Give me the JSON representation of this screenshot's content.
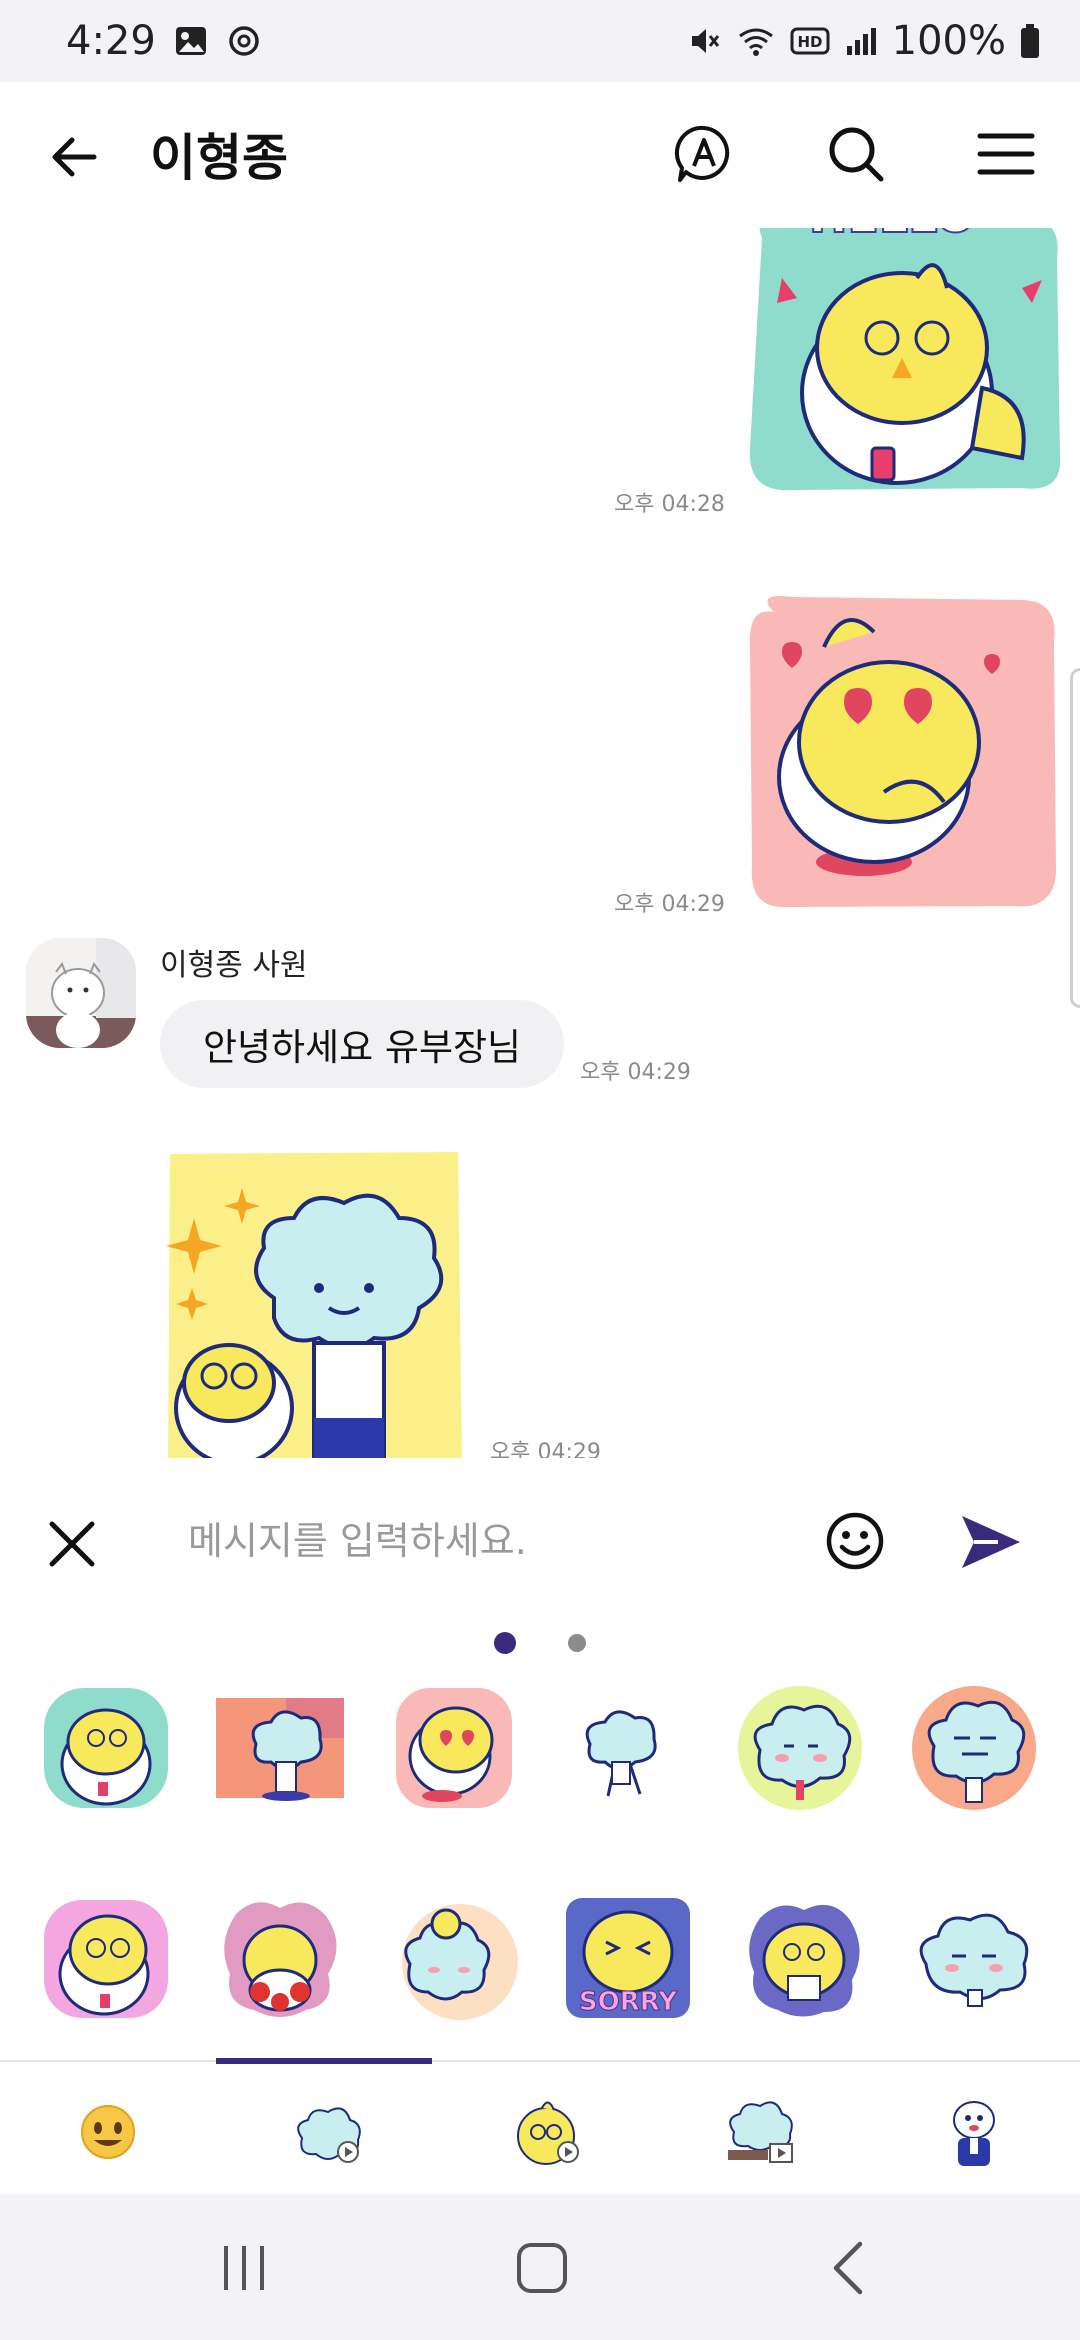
{
  "status_bar": {
    "time": "4:29",
    "battery": "100%",
    "icons": [
      "gallery-icon",
      "sync-icon",
      "mute-icon",
      "wifi-icon",
      "hd-icon",
      "signal-icon",
      "battery-icon"
    ]
  },
  "header": {
    "title": "이형종",
    "icons": [
      "back-arrow-icon",
      "translate-a-icon",
      "search-icon",
      "menu-icon"
    ]
  },
  "messages": [
    {
      "side": "right",
      "type": "sticker",
      "sticker": "hello-chick-sticker",
      "time": "오후 04:28"
    },
    {
      "side": "right",
      "type": "sticker",
      "sticker": "love-chick-sticker",
      "time": "오후 04:29"
    },
    {
      "side": "left",
      "type": "text",
      "sender": "이형종 사원",
      "text": "안녕하세요 유부장님",
      "time": "오후 04:29"
    },
    {
      "side": "left",
      "type": "sticker",
      "sticker": "cloud-and-chick-sticker",
      "time": "오후 04:29"
    }
  ],
  "input": {
    "placeholder": "메시지를 입력하세요."
  },
  "sticker_panel": {
    "page_count": 2,
    "active_page": 1,
    "row1": [
      "chick-glasses-sticker",
      "cloud-walking-sticker",
      "chick-heart-eyes-sticker",
      "cloud-running-sticker",
      "cloud-blush-sticker",
      "cloud-sleepy-sticker"
    ],
    "row2": [
      "chick-thinking-sticker",
      "chick-flowers-sticker",
      "cloud-chick-hug-sticker",
      "chick-sorry-sticker",
      "chick-reading-sticker",
      "cloud-tired-sticker"
    ],
    "row2_label": "SORRY",
    "tabs": [
      "emoji-tab",
      "cloud-sticker-pack-tab",
      "chick-sticker-pack-tab",
      "cloud-laptop-pack-tab",
      "character-pack-tab"
    ],
    "active_tab": 1
  },
  "colors": {
    "accent": "#3a2a7c",
    "bubble": "#f1f1f3",
    "time_text": "#8a8a8a",
    "chick_yellow": "#f7e85c",
    "cloud_blue": "#c8eef0"
  }
}
